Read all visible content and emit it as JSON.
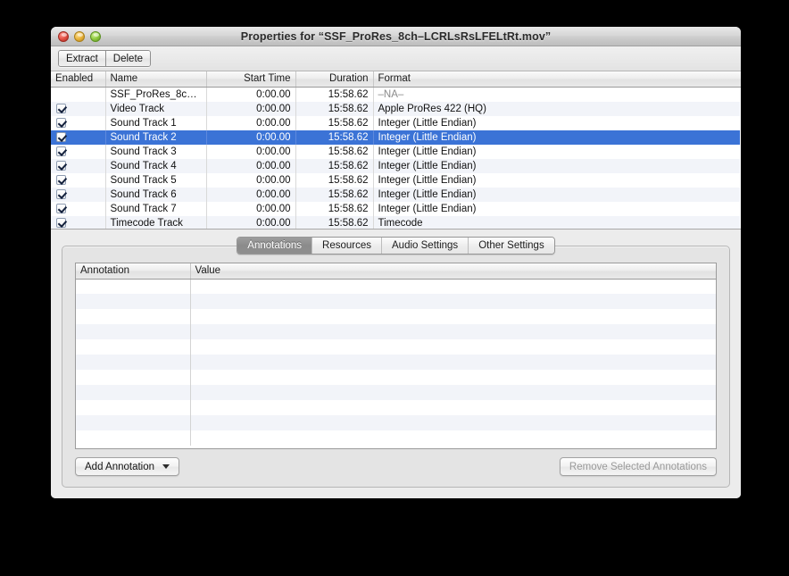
{
  "window": {
    "title": "Properties for “SSF_ProRes_8ch–LCRLsRsLFELtRt.mov”",
    "traffic_lights": {
      "close": "close-button",
      "minimize": "minimize-button",
      "zoom": "zoom-button"
    }
  },
  "toolbar": {
    "extract_label": "Extract",
    "delete_label": "Delete"
  },
  "tracks_table": {
    "columns": [
      "Enabled",
      "Name",
      "Start Time",
      "Duration",
      "Format"
    ],
    "rows": [
      {
        "enabled": null,
        "name": "SSF_ProRes_8c…",
        "start": "0:00.00",
        "duration": "15:58.62",
        "format": "–NA–",
        "selected": false,
        "format_na": true
      },
      {
        "enabled": true,
        "name": "Video Track",
        "start": "0:00.00",
        "duration": "15:58.62",
        "format": "Apple ProRes 422 (HQ)",
        "selected": false,
        "format_na": false
      },
      {
        "enabled": true,
        "name": "Sound Track 1",
        "start": "0:00.00",
        "duration": "15:58.62",
        "format": "Integer (Little Endian)",
        "selected": false,
        "format_na": false
      },
      {
        "enabled": true,
        "name": "Sound Track 2",
        "start": "0:00.00",
        "duration": "15:58.62",
        "format": "Integer (Little Endian)",
        "selected": true,
        "format_na": false
      },
      {
        "enabled": true,
        "name": "Sound Track 3",
        "start": "0:00.00",
        "duration": "15:58.62",
        "format": "Integer (Little Endian)",
        "selected": false,
        "format_na": false
      },
      {
        "enabled": true,
        "name": "Sound Track 4",
        "start": "0:00.00",
        "duration": "15:58.62",
        "format": "Integer (Little Endian)",
        "selected": false,
        "format_na": false
      },
      {
        "enabled": true,
        "name": "Sound Track 5",
        "start": "0:00.00",
        "duration": "15:58.62",
        "format": "Integer (Little Endian)",
        "selected": false,
        "format_na": false
      },
      {
        "enabled": true,
        "name": "Sound Track 6",
        "start": "0:00.00",
        "duration": "15:58.62",
        "format": "Integer (Little Endian)",
        "selected": false,
        "format_na": false
      },
      {
        "enabled": true,
        "name": "Sound Track 7",
        "start": "0:00.00",
        "duration": "15:58.62",
        "format": "Integer (Little Endian)",
        "selected": false,
        "format_na": false
      },
      {
        "enabled": true,
        "name": "Timecode Track",
        "start": "0:00.00",
        "duration": "15:58.62",
        "format": "Timecode",
        "selected": false,
        "format_na": false
      }
    ]
  },
  "tabs": [
    {
      "label": "Annotations",
      "active": true
    },
    {
      "label": "Resources",
      "active": false
    },
    {
      "label": "Audio Settings",
      "active": false
    },
    {
      "label": "Other Settings",
      "active": false
    }
  ],
  "annotations_panel": {
    "columns": [
      "Annotation",
      "Value"
    ],
    "rows": [],
    "empty_row_count": 11,
    "add_button_label": "Add Annotation",
    "add_button_icon": "caret-down-icon",
    "remove_button_label": "Remove Selected Annotations",
    "remove_button_disabled": true
  },
  "colors": {
    "selection_blue": "#3b73d6",
    "window_chrome": "#ececec",
    "stripe": "#f2f4f9",
    "panel": "#e4e4e4"
  }
}
